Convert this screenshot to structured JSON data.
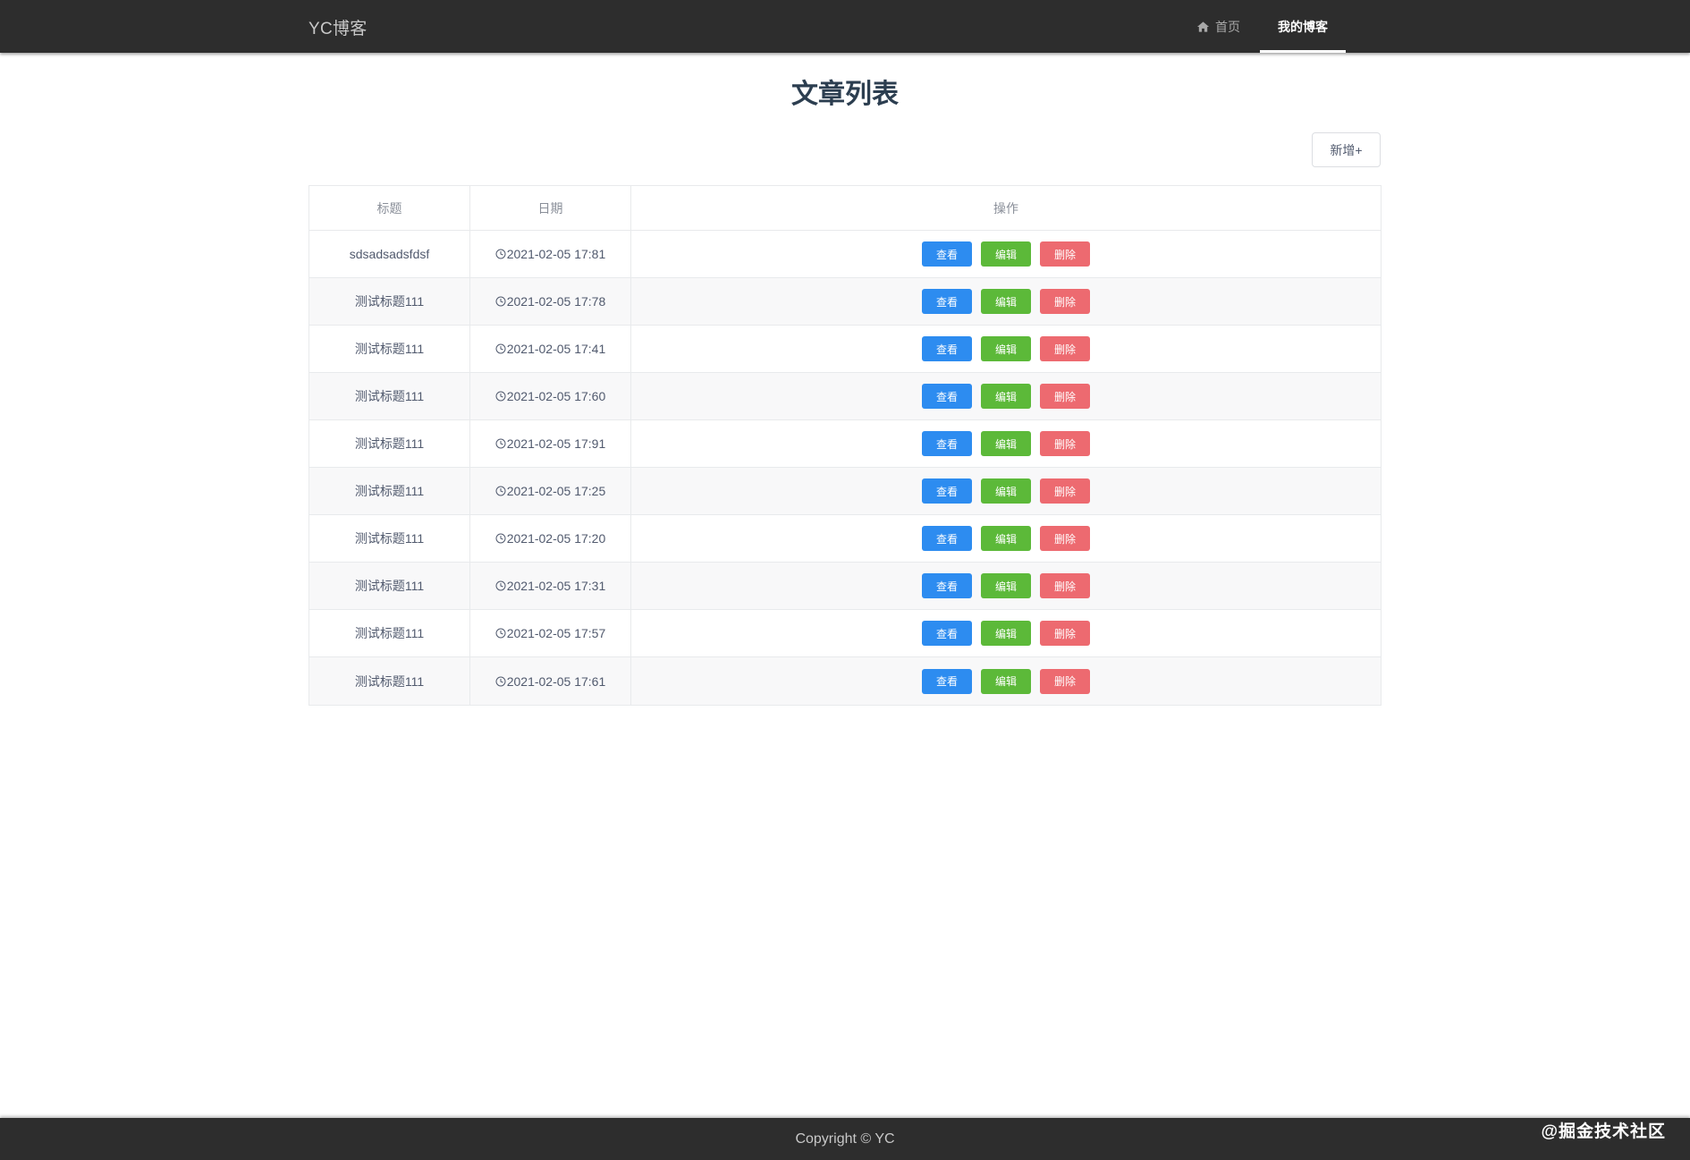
{
  "header": {
    "brand": "YC博客",
    "nav": [
      {
        "label": "首页",
        "icon": "home-icon"
      },
      {
        "label": "我的博客",
        "active": true
      }
    ]
  },
  "page": {
    "title": "文章列表",
    "add_button": "新增+"
  },
  "table": {
    "columns": [
      "标题",
      "日期",
      "操作"
    ],
    "actions": {
      "view": "查看",
      "edit": "编辑",
      "delete": "删除"
    },
    "rows": [
      {
        "title": "sdsadsadsfdsf",
        "date": "2021-02-05 17:81"
      },
      {
        "title": "测试标题111",
        "date": "2021-02-05 17:78"
      },
      {
        "title": "测试标题111",
        "date": "2021-02-05 17:41"
      },
      {
        "title": "测试标题111",
        "date": "2021-02-05 17:60"
      },
      {
        "title": "测试标题111",
        "date": "2021-02-05 17:91"
      },
      {
        "title": "测试标题111",
        "date": "2021-02-05 17:25"
      },
      {
        "title": "测试标题111",
        "date": "2021-02-05 17:20"
      },
      {
        "title": "测试标题111",
        "date": "2021-02-05 17:31"
      },
      {
        "title": "测试标题111",
        "date": "2021-02-05 17:57"
      },
      {
        "title": "测试标题111",
        "date": "2021-02-05 17:61"
      }
    ]
  },
  "footer": {
    "copyright": "Copyright © YC"
  },
  "watermark": "@掘金技术社区",
  "colors": {
    "header_bg": "#2d2d2d",
    "view": "#2d8cf0",
    "edit": "#5cb939",
    "delete": "#ed6a70"
  }
}
